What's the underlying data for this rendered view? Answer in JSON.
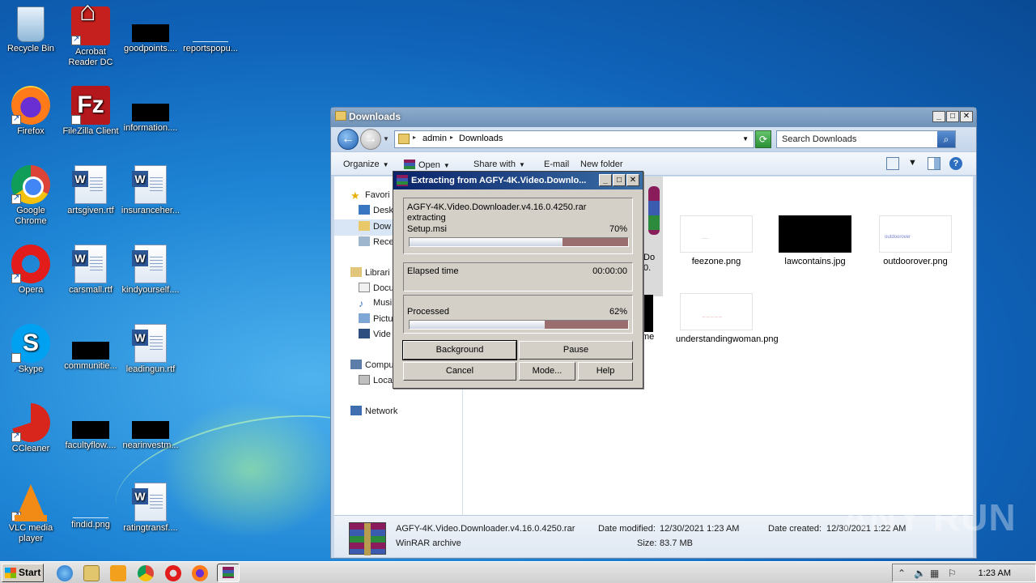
{
  "desktop": {
    "icons": [
      {
        "label": "Recycle Bin",
        "icon": "recycle-bin-icon"
      },
      {
        "label": "Acrobat Reader DC",
        "icon": "acrobat-reader-icon"
      },
      {
        "label": "goodpoints....",
        "icon": "black-thumbnail-icon"
      },
      {
        "label": "reportspopu...",
        "icon": "blank-thumbnail-icon"
      },
      {
        "label": "Firefox",
        "icon": "firefox-icon"
      },
      {
        "label": "FileZilla Client",
        "icon": "filezilla-icon"
      },
      {
        "label": "information....",
        "icon": "black-thumbnail-icon"
      },
      {
        "label": "Google Chrome",
        "icon": "chrome-icon"
      },
      {
        "label": "artsgiven.rtf",
        "icon": "word-document-icon"
      },
      {
        "label": "insuranceher...",
        "icon": "word-document-icon"
      },
      {
        "label": "Opera",
        "icon": "opera-icon"
      },
      {
        "label": "carsmall.rtf",
        "icon": "word-document-icon"
      },
      {
        "label": "kindyourself....",
        "icon": "word-document-icon"
      },
      {
        "label": "Skype",
        "icon": "skype-icon"
      },
      {
        "label": "communitie...",
        "icon": "black-thumbnail-icon"
      },
      {
        "label": "leadingun.rtf",
        "icon": "word-document-icon"
      },
      {
        "label": "CCleaner",
        "icon": "ccleaner-icon"
      },
      {
        "label": "facultyflow....",
        "icon": "black-thumbnail-icon"
      },
      {
        "label": "nearinvestm...",
        "icon": "black-thumbnail-icon"
      },
      {
        "label": "VLC media player",
        "icon": "vlc-icon"
      },
      {
        "label": "findid.png",
        "icon": "blank-thumbnail-icon"
      },
      {
        "label": "ratingtransf....",
        "icon": "word-document-icon"
      }
    ]
  },
  "explorer": {
    "title": "Downloads",
    "breadcrumb": [
      "admin",
      "Downloads"
    ],
    "search_placeholder": "Search Downloads",
    "toolbar": {
      "organize": "Organize",
      "open": "Open",
      "share_with": "Share with",
      "email": "E-mail",
      "new_folder": "New folder"
    },
    "navpane": {
      "favorites": "Favori",
      "desktop": "Desk",
      "downloads": "Dow",
      "recent": "Rece",
      "libraries": "Librari",
      "documents": "Docu",
      "music": "Musi",
      "pictures": "Pictu",
      "videos": "Vide",
      "computer": "Compu",
      "local_disk": "Loca",
      "network": "Network"
    },
    "files": [
      {
        "name": "feezone.png"
      },
      {
        "name": "lawcontains.jpg"
      },
      {
        "name": "outdoorover.png",
        "thumb_text": "outdoorover"
      },
      {
        "name": "understandingwoman.png"
      }
    ],
    "partial_labels": {
      "do": "Do",
      "zero": "0.",
      "me": "me"
    },
    "details": {
      "filename": "AGFY-4K.Video.Downloader.v4.16.0.4250.rar",
      "type": "WinRAR archive",
      "date_modified_label": "Date modified:",
      "date_modified": "12/30/2021 1:23 AM",
      "size_label": "Size:",
      "size": "83.7 MB",
      "date_created_label": "Date created:",
      "date_created": "12/30/2021 1:22 AM"
    }
  },
  "dialog": {
    "title": "Extracting from AGFY-4K.Video.Downlo...",
    "archive": "AGFY-4K.Video.Downloader.v4.16.0.4250.rar",
    "action": "extracting",
    "current_file": "Setup.msi",
    "file_percent_text": "70%",
    "file_progress": 0.7,
    "elapsed_label": "Elapsed time",
    "elapsed_value": "00:00:00",
    "processed_label": "Processed",
    "processed_percent_text": "62%",
    "processed_progress": 0.62,
    "buttons": {
      "background": "Background",
      "pause": "Pause",
      "cancel": "Cancel",
      "mode": "Mode...",
      "help": "Help"
    }
  },
  "taskbar": {
    "start": "Start",
    "clock": "1:23 AM"
  },
  "watermark": "ANY RUN"
}
